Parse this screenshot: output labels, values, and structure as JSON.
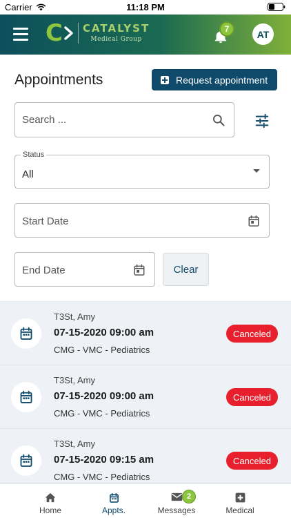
{
  "status_bar": {
    "carrier": "Carrier",
    "time": "11:18 PM"
  },
  "header": {
    "logo_letter": "C",
    "logo_name": "CATALYST",
    "logo_sub": "Medical Group",
    "notification_count": "7",
    "avatar_initials": "AT"
  },
  "page": {
    "title": "Appointments",
    "request_button_label": "Request appointment"
  },
  "search": {
    "placeholder": "Search ..."
  },
  "filters": {
    "status_label": "Status",
    "status_value": "All",
    "start_date_placeholder": "Start Date",
    "end_date_placeholder": "End Date",
    "clear_label": "Clear"
  },
  "appointments": [
    {
      "patient": "T3St, Amy",
      "datetime": "07-15-2020 09:00 am",
      "location": "CMG - VMC - Pediatrics",
      "status": "Canceled"
    },
    {
      "patient": "T3St, Amy",
      "datetime": "07-15-2020 09:00 am",
      "location": "CMG - VMC - Pediatrics",
      "status": "Canceled"
    },
    {
      "patient": "T3St, Amy",
      "datetime": "07-15-2020 09:15 am",
      "location": "CMG - VMC - Pediatrics",
      "status": "Canceled"
    }
  ],
  "tabs": [
    {
      "label": "Home",
      "icon": "home-icon"
    },
    {
      "label": "Appts.",
      "icon": "calendar-icon",
      "active": true
    },
    {
      "label": "Messages",
      "icon": "envelope-icon",
      "badge": "2"
    },
    {
      "label": "Medical",
      "icon": "medical-cross-icon"
    }
  ],
  "colors": {
    "primary": "#0f4a6b",
    "accent_green": "#8cc63f",
    "canceled": "#e8202e"
  }
}
